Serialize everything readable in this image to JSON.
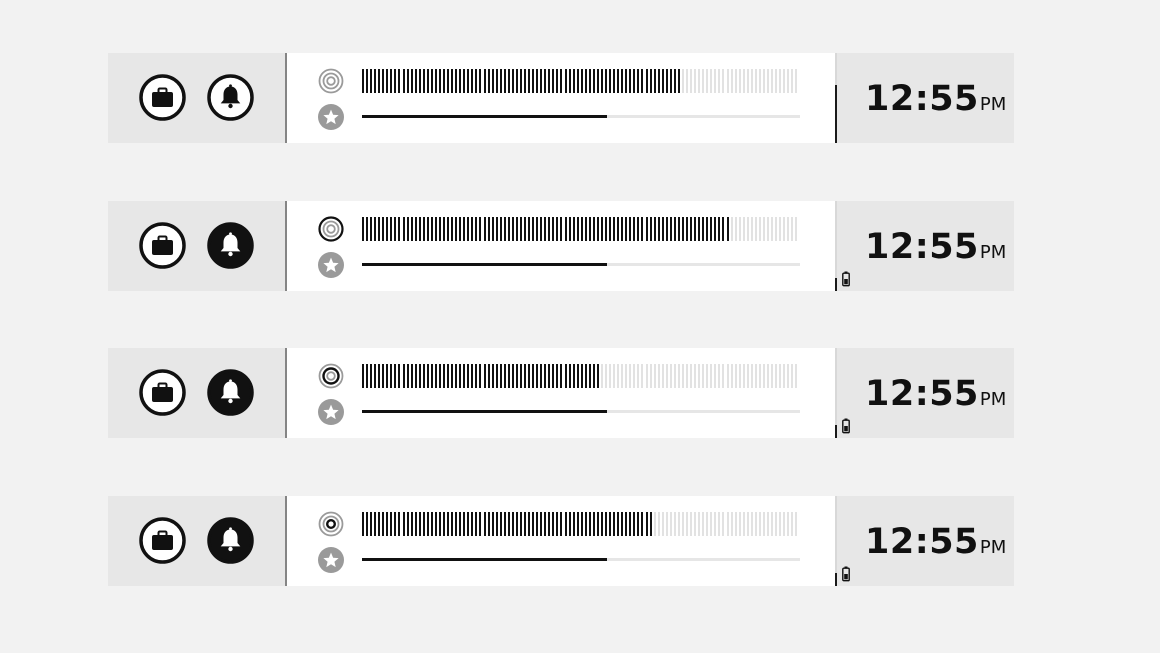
{
  "colors": {
    "page_background": "#f2f2f2",
    "side_panel": "#e7e7e7",
    "center_panel": "#ffffff",
    "foreground": "#111111",
    "meter_inactive": "#e2e2e2",
    "icon_grey": "#9a9a9a"
  },
  "widgets": [
    {
      "briefcase_icon": "briefcase-icon",
      "bell_icon": "bell-icon",
      "bell_style": "outline",
      "signal_icon": "concentric-circles-icon",
      "signal_state": "all-outer",
      "star_icon": "star-icon",
      "meter_level": 0.73,
      "slider_level": 0.56,
      "divider_fill": 0.65,
      "battery_visible": false,
      "time": "12:55",
      "ampm": "PM"
    },
    {
      "briefcase_icon": "briefcase-icon",
      "bell_icon": "bell-icon",
      "bell_style": "filled",
      "signal_icon": "concentric-circles-icon",
      "signal_state": "outer",
      "star_icon": "star-icon",
      "meter_level": 0.84,
      "slider_level": 0.56,
      "divider_fill": 0.15,
      "battery_visible": true,
      "time": "12:55",
      "ampm": "PM"
    },
    {
      "briefcase_icon": "briefcase-icon",
      "bell_icon": "bell-icon",
      "bell_style": "filled",
      "signal_icon": "concentric-circles-icon",
      "signal_state": "middle",
      "star_icon": "star-icon",
      "meter_level": 0.55,
      "slider_level": 0.56,
      "divider_fill": 0.15,
      "battery_visible": true,
      "time": "12:55",
      "ampm": "PM"
    },
    {
      "briefcase_icon": "briefcase-icon",
      "bell_icon": "bell-icon",
      "bell_style": "filled",
      "signal_icon": "concentric-circles-icon",
      "signal_state": "inner",
      "star_icon": "star-icon",
      "meter_level": 0.67,
      "slider_level": 0.56,
      "divider_fill": 0.15,
      "battery_visible": true,
      "time": "12:55",
      "ampm": "PM"
    }
  ]
}
